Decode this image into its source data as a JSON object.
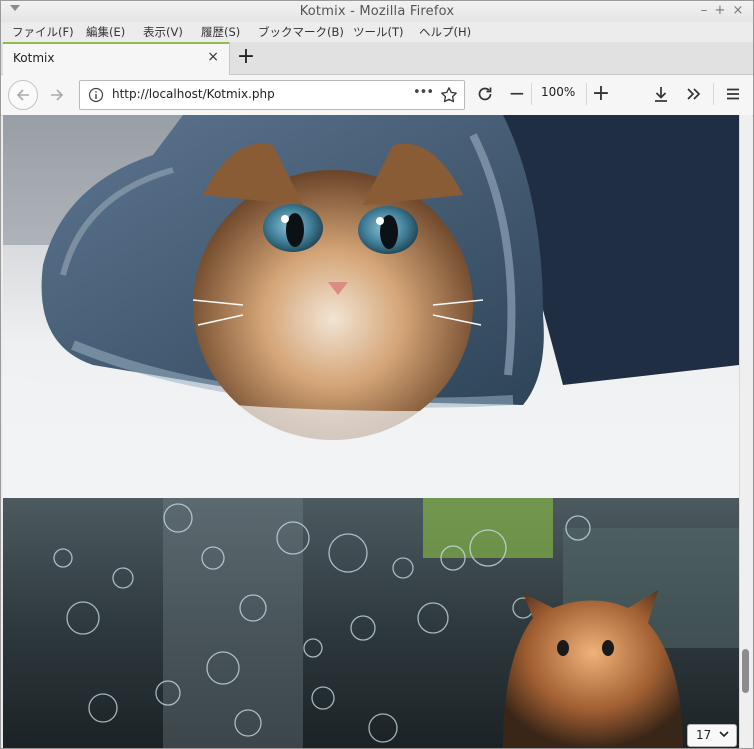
{
  "window": {
    "title": "Kotmix - Mozilla Firefox",
    "controls": {
      "minimize": "–",
      "maximize": "+",
      "close": "×"
    }
  },
  "menu": [
    {
      "label": "ファイル(F)"
    },
    {
      "label": "編集(E)"
    },
    {
      "label": "表示(V)"
    },
    {
      "label": "履歴(S)"
    },
    {
      "label": "ブックマーク(B)"
    },
    {
      "label": "ツール(T)"
    },
    {
      "label": "ヘルプ(H)"
    }
  ],
  "tabs": [
    {
      "label": "Kotmix",
      "close": "×"
    }
  ],
  "newtab_label": "+",
  "navbar": {
    "url": "http://localhost/Kotmix.php",
    "page_actions": "•••",
    "zoom_level": "100%",
    "zoom_out": "−",
    "zoom_in": "+"
  },
  "content": {
    "images": [
      {
        "alt": "kitten-in-denim"
      },
      {
        "alt": "kitten-with-bubbles"
      }
    ]
  },
  "pager": {
    "value": "17"
  },
  "colors": {
    "tab_accent": "#8fbc4d",
    "chrome": "#ececec"
  }
}
